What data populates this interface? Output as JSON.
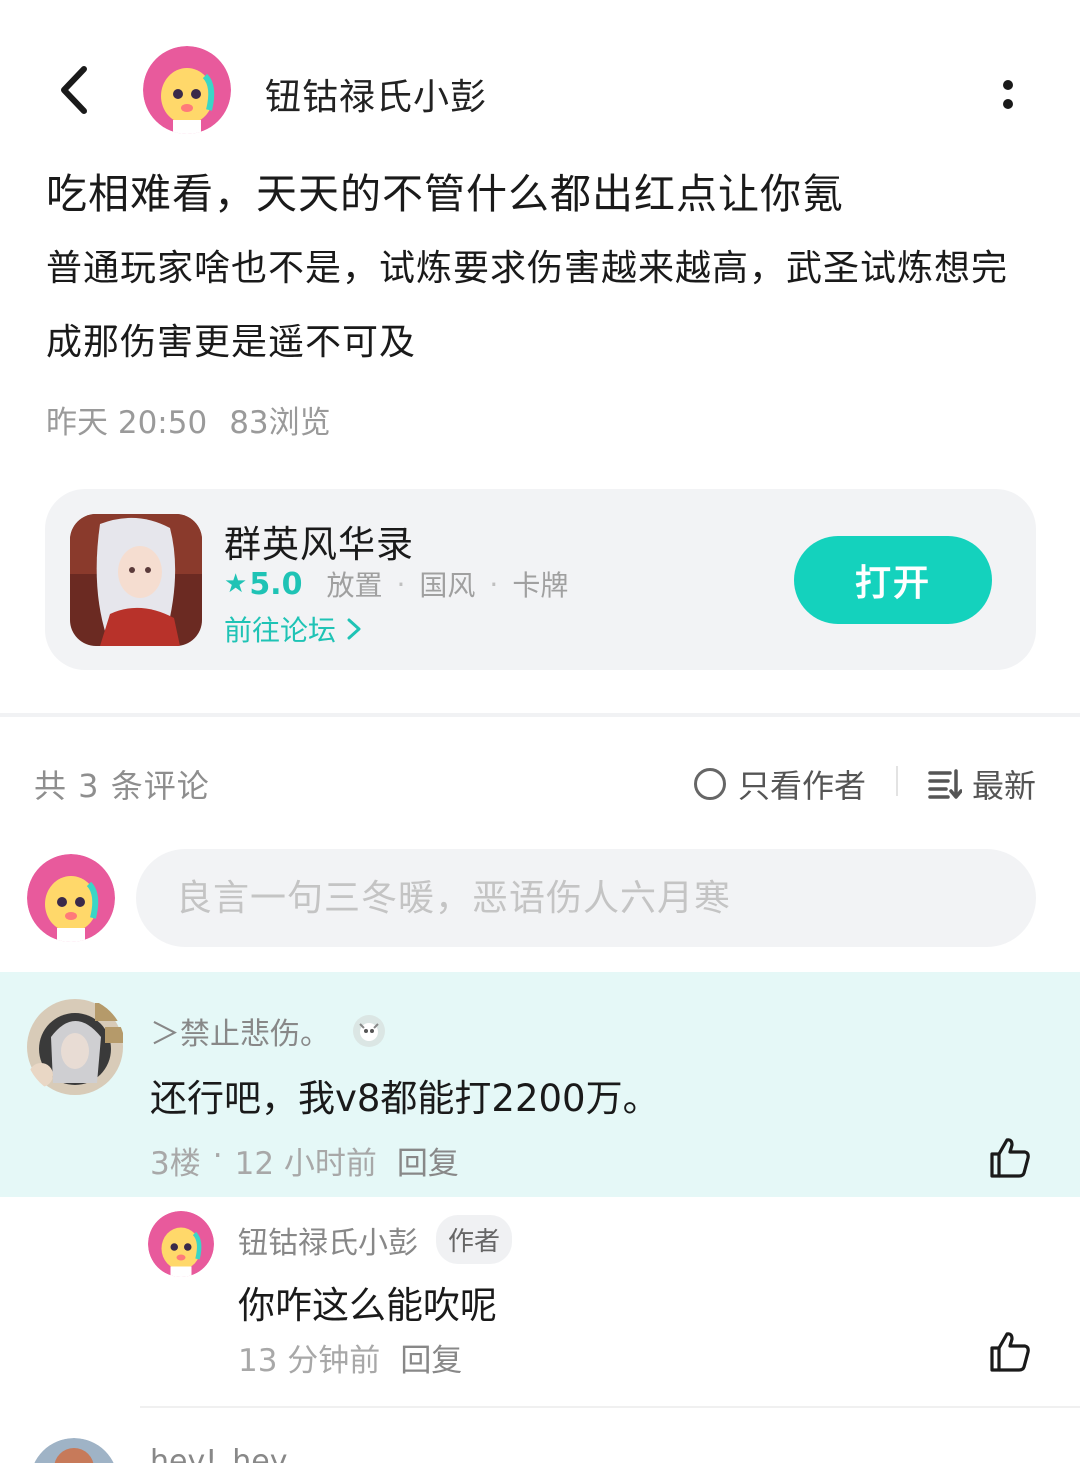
{
  "header": {
    "back_icon": "chevron-left-icon",
    "author_name": "钮钴禄氏小彭",
    "more_icon": "more-vertical-icon"
  },
  "post": {
    "title": "吃相难看，天天的不管什么都出红点让你氪",
    "body": "普通玩家啥也不是，试炼要求伤害越来越高，武圣试炼想完成那伤害更是遥不可及",
    "time": "昨天 20:50",
    "views": "83浏览"
  },
  "game_card": {
    "name": "群英风华录",
    "rating": "5.0",
    "tags": [
      "放置",
      "国风",
      "卡牌"
    ],
    "forum_link": "前往论坛",
    "open_label": "打开",
    "accent": "#14d2bd"
  },
  "comments_header": {
    "count_label": "共 3 条评论",
    "only_author_label": "只看作者",
    "sort_label": "最新"
  },
  "composer": {
    "placeholder": "良言一句三冬暖，恶语伤人六月寒"
  },
  "comments": [
    {
      "user": "＞禁止悲伤。",
      "text": "还行吧，我v8都能打2200万。",
      "floor": "3楼",
      "time": "12 小时前",
      "reply_label": "回复"
    }
  ],
  "replies": [
    {
      "user": "钮钴禄氏小彭",
      "tag": "作者",
      "text": "你咋这么能吹呢",
      "time": "13 分钟前",
      "reply_label": "回复"
    }
  ],
  "next_comment": {
    "user": "hey!_hey"
  }
}
